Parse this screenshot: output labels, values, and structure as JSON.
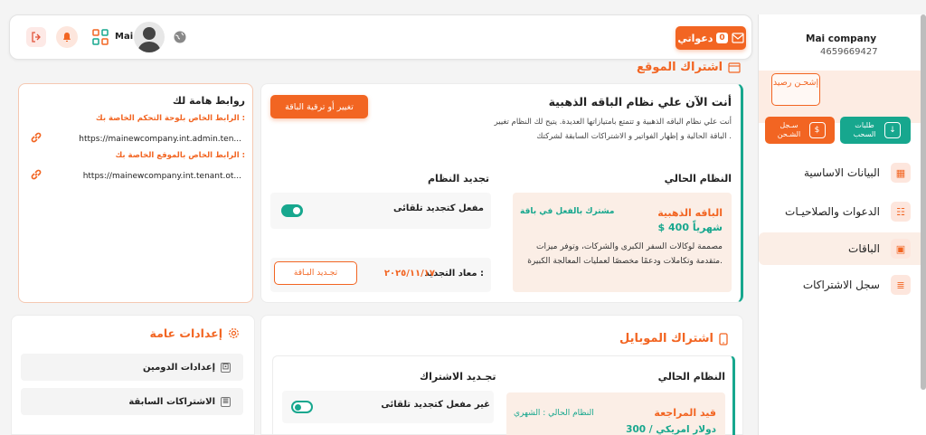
{
  "header": {
    "user_name": "Mai",
    "invites_label": "دعواتي",
    "invites_count": "0"
  },
  "sidebar": {
    "company_name": "Mai company",
    "company_id": "4659669427",
    "recharge_label": "إشحـن رصيد",
    "recharge_log_label": "سـجل الشـحن",
    "withdraw_label": "طلبات السحب",
    "items": [
      {
        "label": "البيانات الاساسية",
        "icon": "building-icon"
      },
      {
        "label": "الدعوات والصلاحيـات",
        "icon": "users-icon"
      },
      {
        "label": "الباقات",
        "icon": "package-icon"
      },
      {
        "label": "سجل الاشتراكات",
        "icon": "list-icon"
      }
    ]
  },
  "site_subscription": {
    "section_title": "اشتراك الموقع",
    "heading": "أنت الآن علي نظام الباقه الذهبية",
    "description": "أنت علي نظام الباقه الذهبية و تتمتع بامتيازاتها العديدة. يتيح لك النظام تغيير الباقة الحالية و إظهار الفواتير و الاشتراكات السابقة لشركتك .",
    "upgrade_button": "تغيير أو ترقية الباقة",
    "current_system_label": "النظام الحالي",
    "renew_system_label": "تجديد النظام",
    "plan_name": "الباقه الذهبية",
    "plan_status": "مشترك بالفعل في باقة",
    "plan_price": "$ 400 شهرياً",
    "plan_details": "مصممة لوكالات السفر الكبرى والشركات، وتوفر ميزات متقدمة وتكاملات ودعمًا مخصصًا لعمليات المعالجة الكبيرة.",
    "auto_renew_text": "مفعل كتجديد تلقائى",
    "auto_renew_on": true,
    "renew_date_label": "معاد التجديد :",
    "renew_date_value": "٢٠٢٥/١١/١٧",
    "renew_button": "تجـديد البـاقة"
  },
  "links": {
    "title": "روابط هامة لك",
    "items": [
      {
        "label": "الرابط الخاص بلوحة التحكم الخاصة بك :",
        "url": "https://mainewcompany.int.admin.ten..."
      },
      {
        "label": "الرابط الخاص بالموقع الخاصة بك :",
        "url": "https://mainewcompany.int.tenant.ot..."
      }
    ]
  },
  "mobile_subscription": {
    "section_title": "اشتراك الموبايل",
    "current_system_label": "النظام الحالي",
    "renew_label": "تجـديد الاشتراك",
    "plan_name": "قيد المراجعة",
    "plan_status": "النظام الحالي : الشهري",
    "plan_price": "300 / دولار امريكي",
    "auto_renew_text": "غير مفعل كتجديد تلقائى",
    "auto_renew_on": false
  },
  "settings": {
    "title": "إعدادات عامة",
    "items": [
      {
        "label": "إعدادات الدومين"
      },
      {
        "label": "الاشتراكات السابقة"
      }
    ]
  },
  "colors": {
    "accent": "#f26522",
    "teal": "#17a78e",
    "peach": "#fbeee6"
  }
}
